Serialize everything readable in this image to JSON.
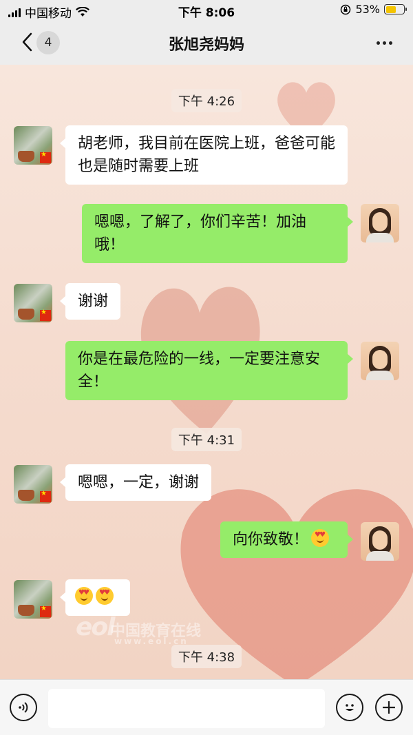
{
  "status_bar": {
    "carrier": "中国移动",
    "time": "下午 8:06",
    "battery_percent": "53%",
    "battery_level": 0.53,
    "icons": [
      "signal-icon",
      "wifi-icon",
      "rotation-lock-icon",
      "battery-icon"
    ]
  },
  "nav": {
    "back_icon": "chevron-left-icon",
    "unread_badge": "4",
    "title": "张旭尧妈妈",
    "more_icon": "more-dots-icon"
  },
  "messages": {
    "ts1": "下午 4:26",
    "m1": "胡老师，我目前在医院上班，爸爸可能也是随时需要上班",
    "m2": "嗯嗯，了解了，你们辛苦！加油哦！",
    "m3": "谢谢",
    "m4": "你是在最危险的一线，一定要注意安全！",
    "ts2": "下午 4:31",
    "m5": "嗯嗯，一定，谢谢",
    "m6": "向你致敬！",
    "m6_emoji": "heart-eyes-emoji",
    "m7_emojis": [
      "heart-eyes-emoji",
      "heart-eyes-emoji"
    ],
    "ts3": "下午 4:38"
  },
  "watermark": {
    "logo": "eol",
    "text": "中国教育在线",
    "url": "www.eol.cn"
  },
  "input_bar": {
    "voice_icon": "voice-icon",
    "text_value": "",
    "emoji_icon": "emoji-icon",
    "plus_icon": "plus-icon"
  },
  "colors": {
    "outgoing_bubble": "#95ec69",
    "incoming_bubble": "#ffffff",
    "bar_background": "#ededed"
  }
}
